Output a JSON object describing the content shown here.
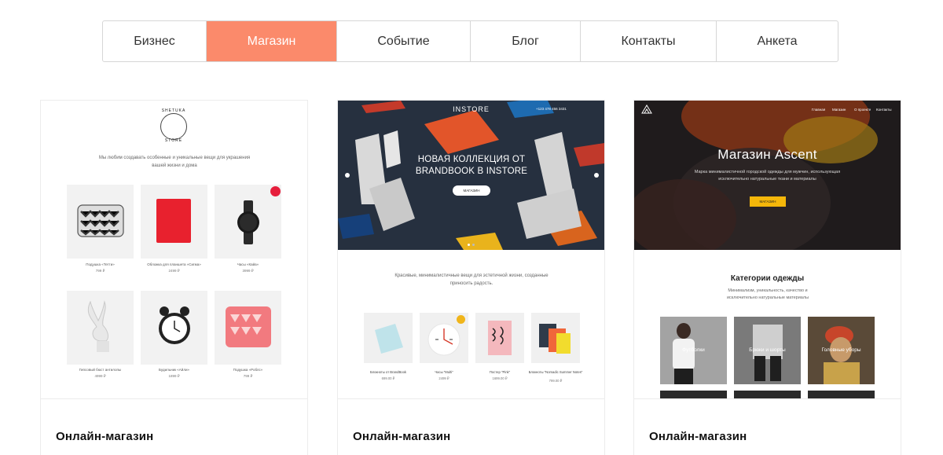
{
  "tabs": [
    {
      "label": "Бизнес",
      "active": false
    },
    {
      "label": "Магазин",
      "active": true
    },
    {
      "label": "Событие",
      "active": false
    },
    {
      "label": "Блог",
      "active": false
    },
    {
      "label": "Контакты",
      "active": false
    },
    {
      "label": "Анкета",
      "active": false
    }
  ],
  "accent_color": "#fb8a6b",
  "cards": [
    {
      "caption": "Онлайн-магазин",
      "preview": {
        "logo_top": "SHETUKA",
        "logo_bottom": "STORE",
        "intro": "Мы любим создавать особенные и уникальные вещи для украшения вашей жизни и дома",
        "products": [
          {
            "name": "Подушка «Тетти»",
            "price": "799 ₽"
          },
          {
            "name": "Обложка для планшета «Сигма»",
            "price": "2499 ₽"
          },
          {
            "name": "Часы «Кайа»",
            "price": "3999 ₽"
          },
          {
            "name": "Гипсовый бюст антилопы",
            "price": "4999 ₽"
          },
          {
            "name": "Будильник «Айли»",
            "price": "1899 ₽"
          },
          {
            "name": "Подушка «Роблс»",
            "price": "799 ₽"
          }
        ]
      }
    },
    {
      "caption": "Онлайн-магазин",
      "preview": {
        "brand": "INSTORE",
        "phone": "+123 478 456 3431",
        "hero_title": "НОВАЯ КОЛЛЕКЦИЯ ОТ BRANDBOOK В INSTORE",
        "hero_button": "МАГАЗИН",
        "intro": "Красивые, минималистичные вещи для эстетичной жизни, созданные приносить радость.",
        "products": [
          {
            "name": "Блокноты от BrandBook",
            "price": "699.00 ₽"
          },
          {
            "name": "Часы \"Multi\"",
            "price": "2499 ₽"
          },
          {
            "name": "Постер \"Pink\"",
            "price": "1699.00 ₽"
          },
          {
            "name": "Блокноты \"Nomadic Summer Notes\"",
            "price": "799.00 ₽"
          }
        ]
      }
    },
    {
      "caption": "Онлайн-магазин",
      "preview": {
        "menu": [
          "Главная",
          "Магазин",
          "О проекте",
          "Контакты"
        ],
        "hero_title": "Магазин Ascent",
        "hero_sub": "Марка минималистичной городской одежды для мужчин, использующая исключительно натуральные ткани и материалы",
        "hero_button": "МАГАЗИН",
        "section_title": "Категории одежды",
        "section_sub": "Минимализм, уникальность, качество и исключительно натуральные материалы",
        "categories": [
          "Футболки",
          "Брюки и шорты",
          "Головные уборы"
        ]
      }
    }
  ]
}
